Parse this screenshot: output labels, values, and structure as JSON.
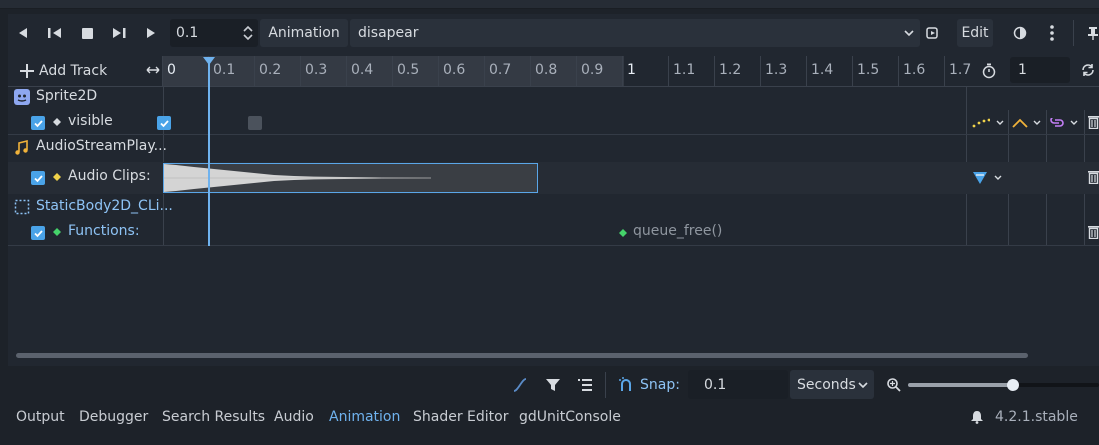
{
  "toolbar": {
    "step_value": "0.1",
    "animation_label": "Animation",
    "animation_name": "disapear",
    "edit_label": "Edit"
  },
  "ruler": {
    "add_track_label": "Add Track",
    "ticks": [
      "0",
      "0.1",
      "0.2",
      "0.3",
      "0.4",
      "0.5",
      "0.6",
      "0.7",
      "0.8",
      "0.9",
      "1",
      "1.1",
      "1.2",
      "1.3",
      "1.4",
      "1.5",
      "1.6",
      "1.7"
    ],
    "length_value": "1"
  },
  "tracks": {
    "sprite_group": "Sprite2D",
    "sprite_prop": "visible",
    "audio_group": "AudioStreamPlay...",
    "audio_prop": "Audio Clips:",
    "static_group": "StaticBody2D_CLi...",
    "static_prop": "Functions:",
    "function_key": "queue_free()"
  },
  "bottom_bar": {
    "snap_label": "Snap:",
    "snap_value": "0.1",
    "unit_value": "Seconds",
    "zoom_level": 0.55
  },
  "tabs": [
    "Output",
    "Debugger",
    "Search Results",
    "Audio",
    "Animation",
    "Shader Editor",
    "gdUnitConsole"
  ],
  "version": "4.2.1.stable",
  "colors": {
    "accent": "#4aa3e8",
    "function_green": "#45d36a",
    "key_yellow": "#f0d24a"
  }
}
